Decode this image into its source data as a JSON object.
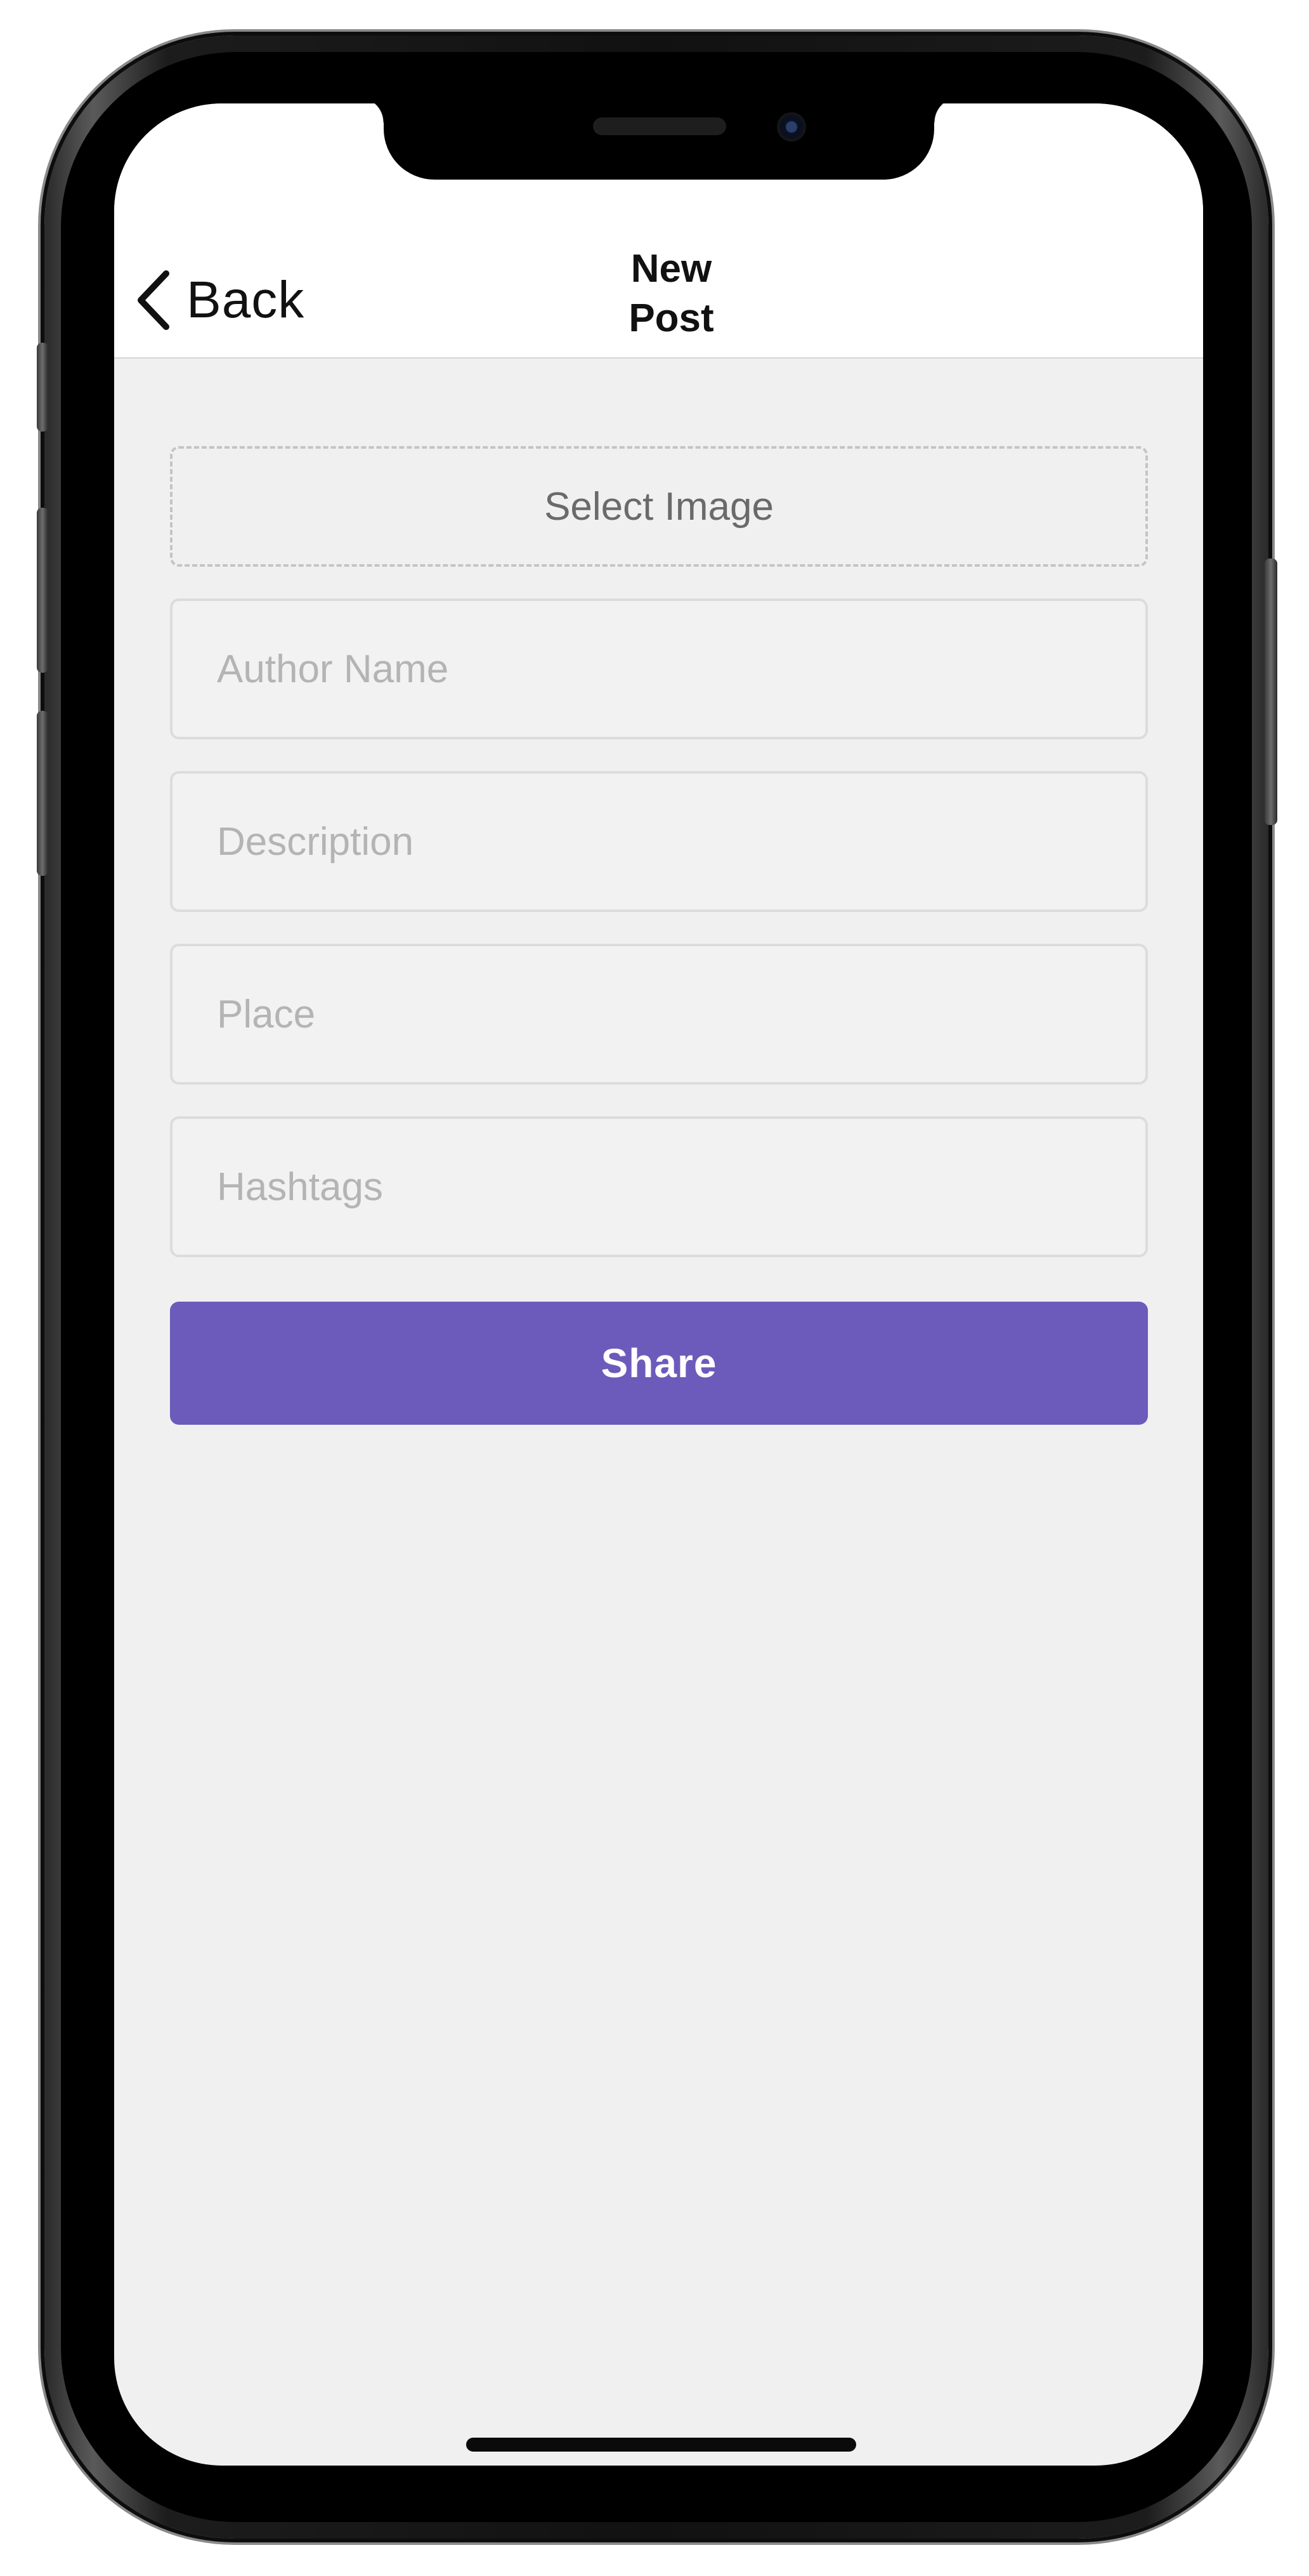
{
  "nav": {
    "back_label": "Back",
    "title": "New Post"
  },
  "form": {
    "select_image_label": "Select Image",
    "fields": [
      {
        "placeholder": "Author Name",
        "value": ""
      },
      {
        "placeholder": "Description",
        "value": ""
      },
      {
        "placeholder": "Place",
        "value": ""
      },
      {
        "placeholder": "Hashtags",
        "value": ""
      }
    ],
    "share_label": "Share"
  },
  "icons": {
    "back": "chevron-left-icon"
  },
  "colors": {
    "accent": "#6c5bbb",
    "background": "#f0f0f0",
    "nav_background": "#ffffff"
  }
}
